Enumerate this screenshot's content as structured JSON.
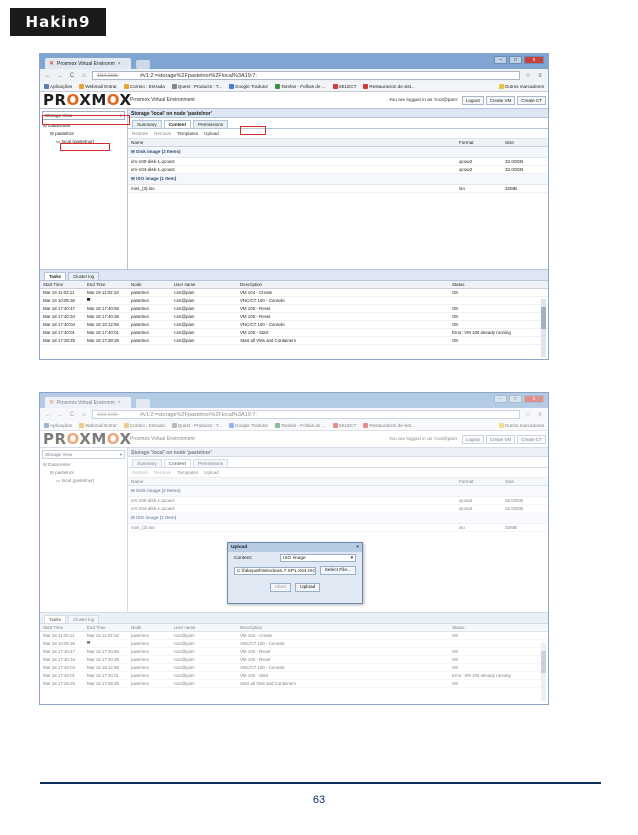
{
  "magazine": {
    "logo": "Hakin9",
    "page_number": "63"
  },
  "browser": {
    "tab_title": "Proxmox Virtual Environm",
    "tab_close": "×",
    "url_host": "192.168.",
    "url_path": "#v1:2:=storage%2Fpastelnor%2Flocal%3A19:7:",
    "nav": {
      "back": "←",
      "forward": "→",
      "reload": "C",
      "home": "⌂"
    },
    "bookmarks": [
      "Aplicações",
      "Webmail Entrar",
      "Correio : Entrada",
      "Quest : Products : T...",
      "Google Tradutor",
      "Tarefas - Folhas de ...",
      "SELECT",
      "Restauracion de sist...",
      "Outros marcadores"
    ]
  },
  "pve": {
    "brand_a": "PR",
    "brand_o": "O",
    "brand_b": "XM",
    "brand_o2": "O",
    "brand_c": "X",
    "title": "Proxmox Virtual Environment",
    "logged": "You are logged in as 'root@pam'",
    "buttons": [
      "Logout",
      "Create VM",
      "Create CT"
    ],
    "view_select": "Storage View",
    "tree": [
      "Datacenter",
      "pastelnor",
      "local (pastelnor)"
    ],
    "storage_header": "Storage 'local' on node 'pastelnor'",
    "tabs": [
      "Summary",
      "Content",
      "Permissions"
    ],
    "actions": [
      "Restore",
      "Remove",
      "Templates",
      "Upload"
    ],
    "columns": {
      "name": "Name",
      "format": "Format",
      "size": "Size"
    },
    "groups": [
      {
        "label": "Disk image (2 Items)",
        "rows": [
          {
            "name": "vm-100-disk-1.qcow2",
            "format": "qcow2",
            "size": "32.00GB"
          },
          {
            "name": "vm-104-disk-1.qcow2",
            "format": "qcow2",
            "size": "32.00GB"
          }
        ]
      },
      {
        "label": "ISO image (1 Item)",
        "rows": [
          {
            "name": "mini_(3).iso",
            "format": "iso",
            "size": "32MB"
          }
        ]
      }
    ],
    "bottom_tabs": [
      "Tasks",
      "Cluster log"
    ],
    "task_columns": [
      "Start Time",
      "End Time",
      "Node",
      "User name",
      "Description",
      "Status"
    ],
    "tasks": [
      {
        "start": "Mar 19 11:02:11",
        "end": "Mar 19 11:02:18",
        "node": "pastelnor",
        "user": "root@pam",
        "desc": "VM 104 - Create",
        "status": "OK"
      },
      {
        "start": "Mar 19 10:05:36",
        "end": "▀",
        "node": "pastelnor",
        "user": "root@pam",
        "desc": "VNC/CT 100 - Console",
        "status": ""
      },
      {
        "start": "Mar 18 17:40:47",
        "end": "Mar 18 17:40:56",
        "node": "pastelnor",
        "user": "root@pam",
        "desc": "VM 100 - Reset",
        "status": "OK"
      },
      {
        "start": "Mar 18 17:40:34",
        "end": "Mar 18 17:40:36",
        "node": "pastelnor",
        "user": "root@pam",
        "desc": "VM 100 - Reset",
        "status": "OK"
      },
      {
        "start": "Mar 18 17:40:04",
        "end": "Mar 18 18:12:56",
        "node": "pastelnor",
        "user": "root@pam",
        "desc": "VNC/CT 100 - Console",
        "status": "OK"
      },
      {
        "start": "Mar 18 17:40:01",
        "end": "Mar 18 17:40:01",
        "node": "pastelnor",
        "user": "root@pam",
        "desc": "VM 100 - Start",
        "status": "Error: VM 100 already running"
      },
      {
        "start": "Mar 18 17:28:25",
        "end": "Mar 18 17:28:25",
        "node": "pastelnor",
        "user": "root@pam",
        "desc": "Start all VMs and Containers",
        "status": "OK"
      }
    ]
  },
  "upload_dialog": {
    "title": "Upload",
    "close": "×",
    "content_label": "Content:",
    "content_value": "ISO image",
    "file_value": "C:\\fakepath\\Windows.7.SP1.X64.ISO",
    "select_file": "Select File...",
    "abort": "Abort",
    "upload": "Upload"
  },
  "colors": {
    "highlight": "#d62b2b",
    "proxmox_orange": "#e0681c",
    "footer_rule": "#0b2e5c"
  }
}
